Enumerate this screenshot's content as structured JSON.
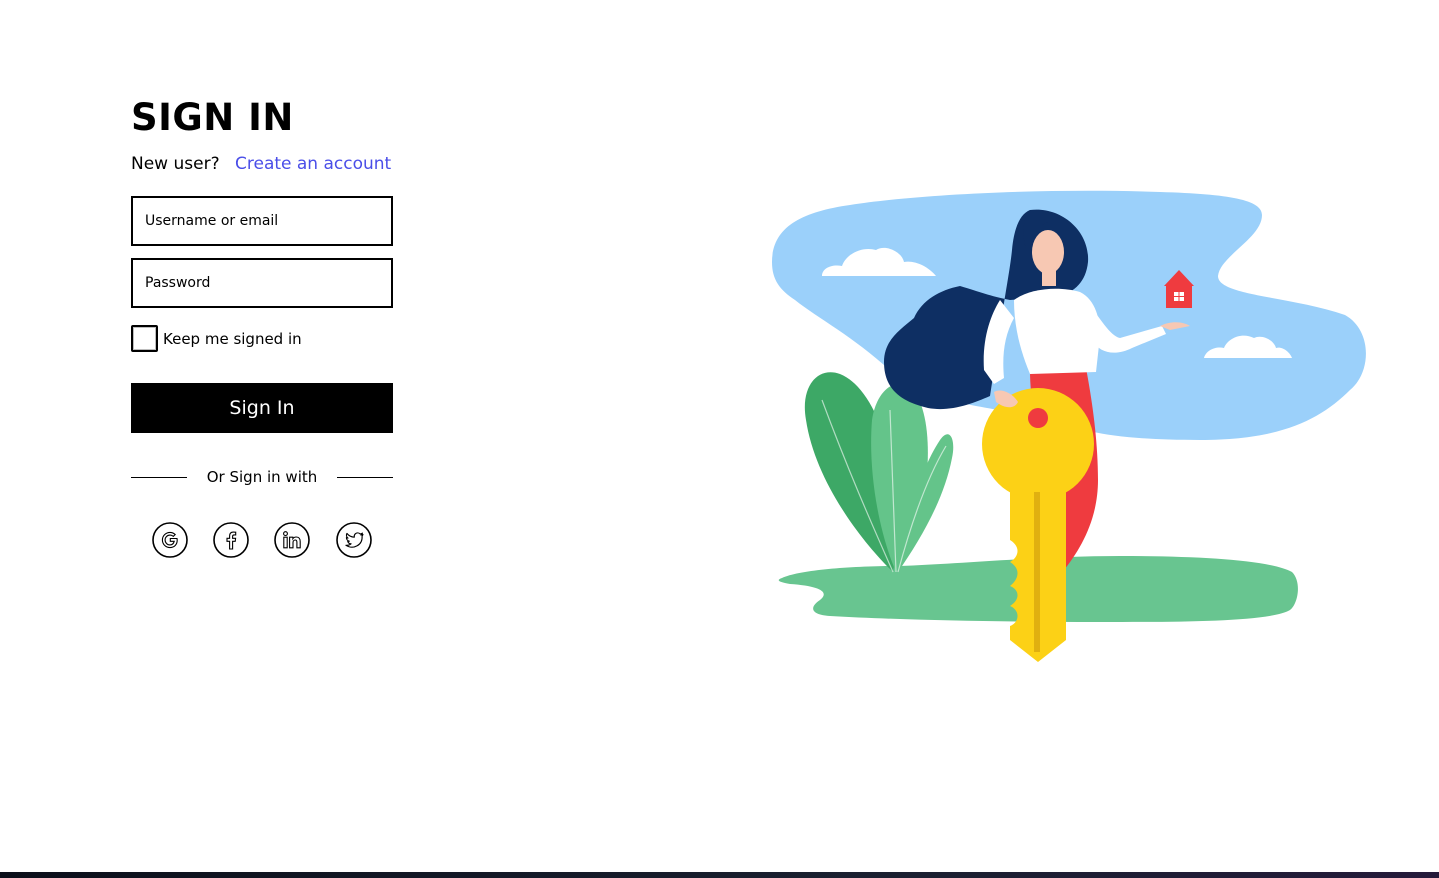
{
  "signin": {
    "title": "SIGN IN",
    "new_user_text": "New user?",
    "create_account_link": "Create an account",
    "username_placeholder": "Username or email",
    "password_placeholder": "Password",
    "keep_signed_in_label": "Keep me signed in",
    "submit_label": "Sign In",
    "divider_text": "Or Sign in with",
    "social": [
      {
        "name": "google",
        "icon": "google-icon"
      },
      {
        "name": "facebook",
        "icon": "facebook-icon"
      },
      {
        "name": "linkedin",
        "icon": "linkedin-icon"
      },
      {
        "name": "twitter",
        "icon": "twitter-icon"
      }
    ]
  },
  "illustration": {
    "subject": "woman-with-key-and-house",
    "colors": {
      "sky": "#9bd0fa",
      "ground": "#68c590",
      "key": "#fcd116",
      "skirt": "#ef3b3f",
      "hair": "#0e2f63",
      "leaf_dark": "#3da866",
      "leaf_light": "#64c48a"
    }
  },
  "colors": {
    "link": "#4a4ee8",
    "button_bg": "#000000",
    "button_text": "#ffffff"
  }
}
